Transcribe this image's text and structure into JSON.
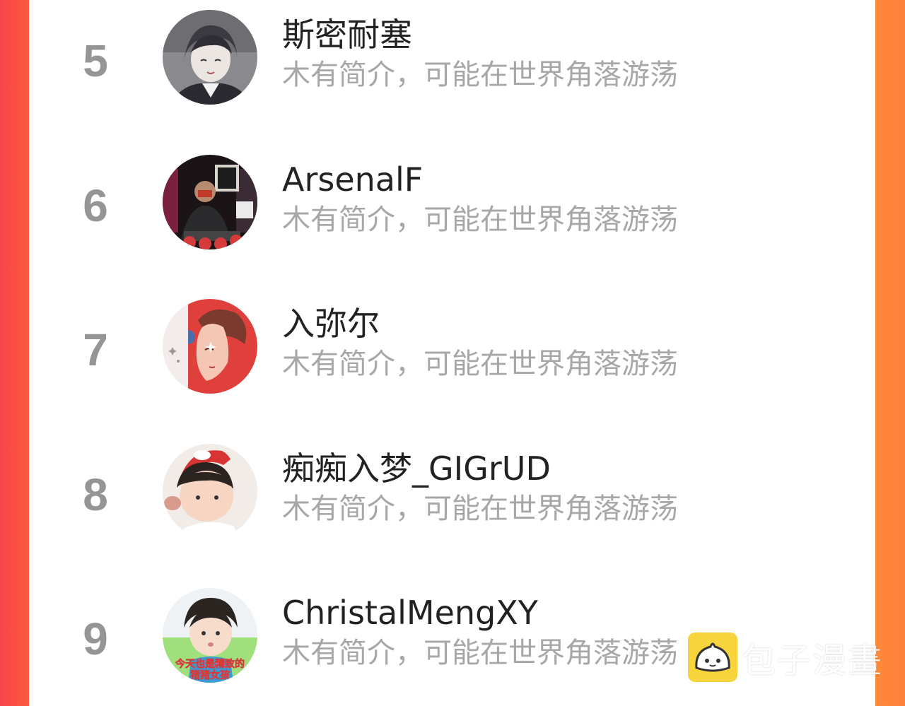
{
  "ranking": {
    "items": [
      {
        "rank": "5",
        "name": "斯密耐塞",
        "bio": "木有简介，可能在世界角落游荡"
      },
      {
        "rank": "6",
        "name": "ArsenalF",
        "bio": "木有简介，可能在世界角落游荡"
      },
      {
        "rank": "7",
        "name": "入弥尔",
        "bio": "木有简介，可能在世界角落游荡"
      },
      {
        "rank": "8",
        "name": "痴痴入梦_GIGrUD",
        "bio": "木有简介，可能在世界角落游荡"
      },
      {
        "rank": "9",
        "name": "ChristalMengXY",
        "bio": "木有简介，可能在世界角落游荡"
      }
    ]
  },
  "avatars": {
    "avatar_9_caption_line1": "今天也是精致的",
    "avatar_9_caption_line2": "猪猪女孩"
  },
  "watermark": {
    "text": "包子漫畫",
    "logo_icon": "bun-mascot-icon"
  },
  "colors": {
    "background_left": "#f8444a",
    "background_right": "#ff8a3a",
    "rank_gray": "#959595",
    "name_color": "#222222",
    "bio_color": "#a7a7a7",
    "logo_yellow": "#f7d33c"
  }
}
